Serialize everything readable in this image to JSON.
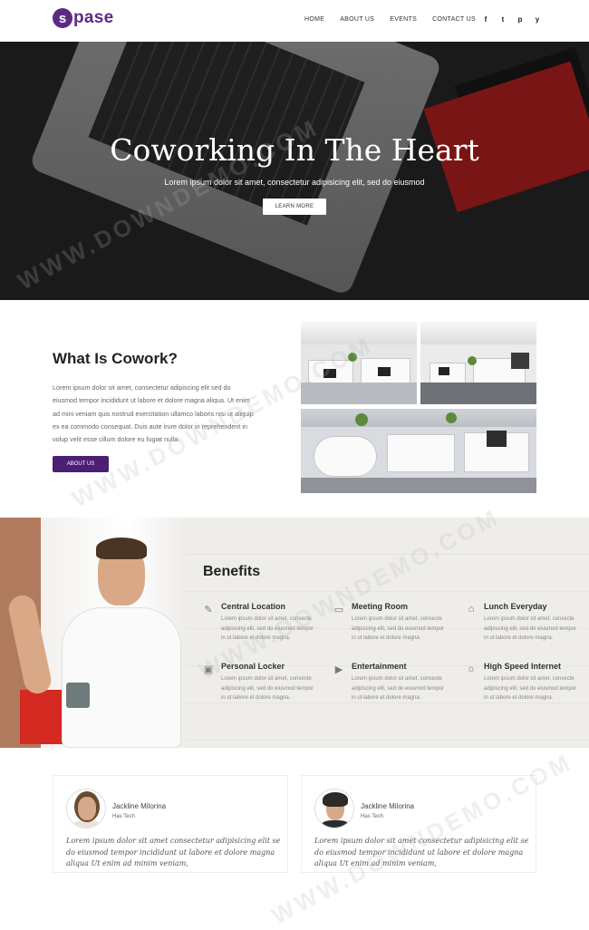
{
  "brand": {
    "mark": "s",
    "name": "pase",
    "color": "#5b2a86"
  },
  "nav": [
    "HOME",
    "ABOUT US",
    "EVENTS",
    "CONTACT US"
  ],
  "social": [
    {
      "icon": "facebook-icon",
      "glyph": "f"
    },
    {
      "icon": "tumblr-icon",
      "glyph": "t"
    },
    {
      "icon": "pinterest-icon",
      "glyph": "p"
    },
    {
      "icon": "twitter-icon",
      "glyph": "y"
    }
  ],
  "hero": {
    "title": "Coworking In The Heart",
    "subtitle": "Lorem ipsum dolor sit amet, consectetur adipisicing elit, sed do eiusmod",
    "button": "LEARN MORE"
  },
  "about": {
    "title": "What Is Cowork?",
    "text": "Lorem ipsum dolor sit amet, consectetur adipiscing elit sed do eiusmod tempor incididunt ut labore et dolore magna aliqua. Ut enim ad mini veniam quis nostrud exercitation ullamco laboris nisi ut aliquip ex ea commodo consequat. Duis aute irure dolor in reprehenderit in volup velit esse cillum dolore eu fugiat nulla.",
    "button": "ABOUT US",
    "button_color": "#4b1f73"
  },
  "benefits": {
    "title": "Benefits",
    "items": [
      {
        "icon": "pencil-icon",
        "glyph": "✎",
        "title": "Central Location",
        "text": "Lorem ipsum dolor sit amet, consecte adipiscing elit, sed do eiusmod tempor in ut labore et dolore magna."
      },
      {
        "icon": "monitor-icon",
        "glyph": "▭",
        "title": "Meeting Room",
        "text": "Lorem ipsum dolor sit amet, consecte adipiscing elit, sed do eiusmod tempor in ut labore et dolore magna."
      },
      {
        "icon": "basket-icon",
        "glyph": "⌂",
        "title": "Lunch Everyday",
        "text": "Lorem ipsum dolor sit amet, consecte adipiscing elit, sed do eiusmod tempor in ut labore et dolore magna."
      },
      {
        "icon": "locker-icon",
        "glyph": "▣",
        "title": "Personal Locker",
        "text": "Lorem ipsum dolor sit amet, consecte adipiscing elit, sed do eiusmod tempor in ut labore et dolore magna."
      },
      {
        "icon": "film-icon",
        "glyph": "▶",
        "title": "Entertainment",
        "text": "Lorem ipsum dolor sit amet, consecte adipiscing elit, sed do eiusmod tempor in ut labore et dolore magna."
      },
      {
        "icon": "wifi-icon",
        "glyph": "☼",
        "title": "High Speed Internet",
        "text": "Lorem ipsum dolor sit amet, consecte adipiscing elit, sed do eiusmod tempor in ut labore et dolore magna."
      }
    ]
  },
  "testimonials": [
    {
      "name": "Jackline Milorina",
      "company": "Has Tech",
      "quote": "Lorem ipsum dolor sit amet consectetur adipisicing elit se do eiusmod tempor incididunt ut labore et dolore magna aliqua Ut enim ad minim veniam,"
    },
    {
      "name": "Jackline Milorina",
      "company": "Has Tech",
      "quote": "Lorem ipsum dolor sit amet consectetur adipisicing elit se do eiusmod tempor incididunt ut labore et dolore magna aliqua Ut enim ad minim veniam,"
    }
  ],
  "watermark": "WWW.DOWNDEMO.COM"
}
